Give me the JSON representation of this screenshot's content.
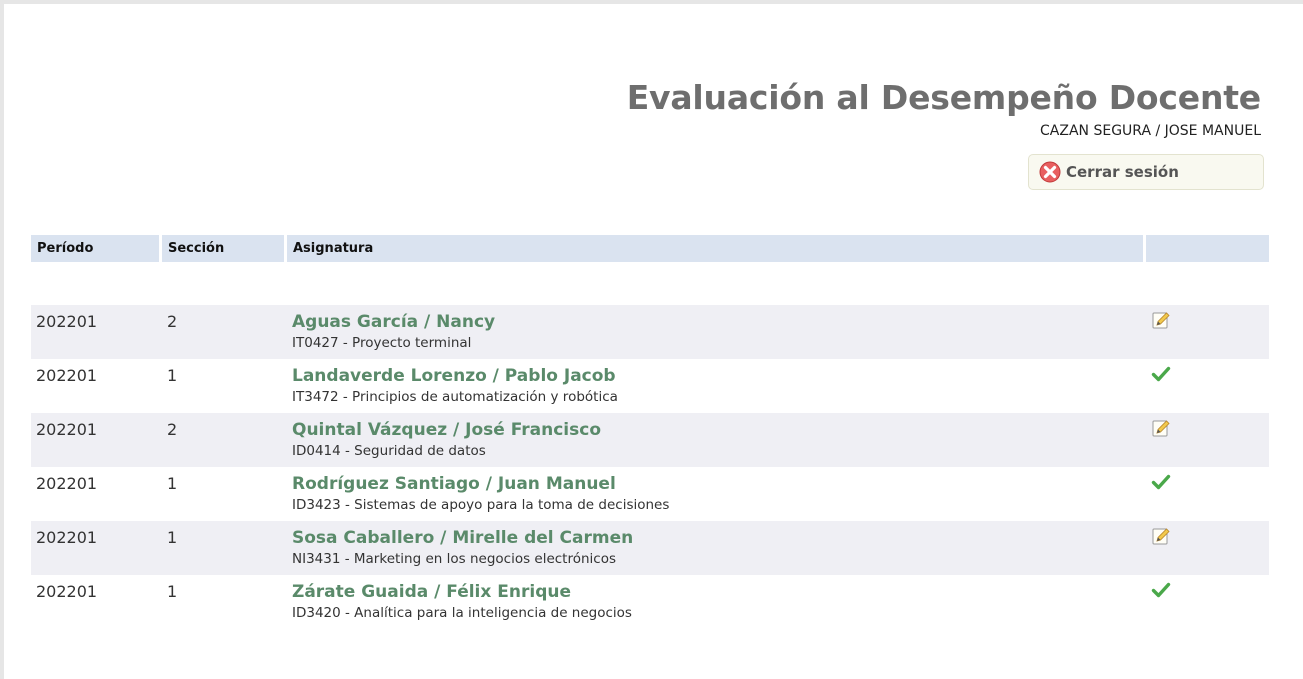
{
  "header": {
    "title": "Evaluación al Desempeño Docente",
    "user": "CAZAN SEGURA / JOSE MANUEL",
    "logout_label": "Cerrar sesión"
  },
  "table": {
    "columns": [
      "Período",
      "Sección",
      "Asignatura",
      ""
    ],
    "rows": [
      {
        "periodo": "202201",
        "seccion": "2",
        "teacher": "Aguas García / Nancy",
        "course": "IT0427 - Proyecto terminal",
        "status": "edit-icon"
      },
      {
        "periodo": "202201",
        "seccion": "1",
        "teacher": "Landaverde Lorenzo / Pablo Jacob",
        "course": "IT3472 - Principios de automatización y robótica",
        "status": "check-icon"
      },
      {
        "periodo": "202201",
        "seccion": "2",
        "teacher": "Quintal Vázquez / José Francisco",
        "course": "ID0414 - Seguridad de datos",
        "status": "edit-icon"
      },
      {
        "periodo": "202201",
        "seccion": "1",
        "teacher": "Rodríguez Santiago / Juan Manuel",
        "course": "ID3423 - Sistemas de apoyo para la toma de decisiones",
        "status": "check-icon"
      },
      {
        "periodo": "202201",
        "seccion": "1",
        "teacher": "Sosa Caballero / Mirelle del Carmen",
        "course": "NI3431 - Marketing en los negocios electrónicos",
        "status": "edit-icon"
      },
      {
        "periodo": "202201",
        "seccion": "1",
        "teacher": "Zárate Guaida / Félix Enrique",
        "course": "ID3420 - Analítica para la inteligencia de negocios",
        "status": "check-icon"
      }
    ]
  },
  "colors": {
    "title": "#6e6e6e",
    "teacher_link": "#5a8a6a",
    "header_bg": "#dae3f0",
    "row_shade": "#efeff4",
    "check": "#4aa84a"
  }
}
